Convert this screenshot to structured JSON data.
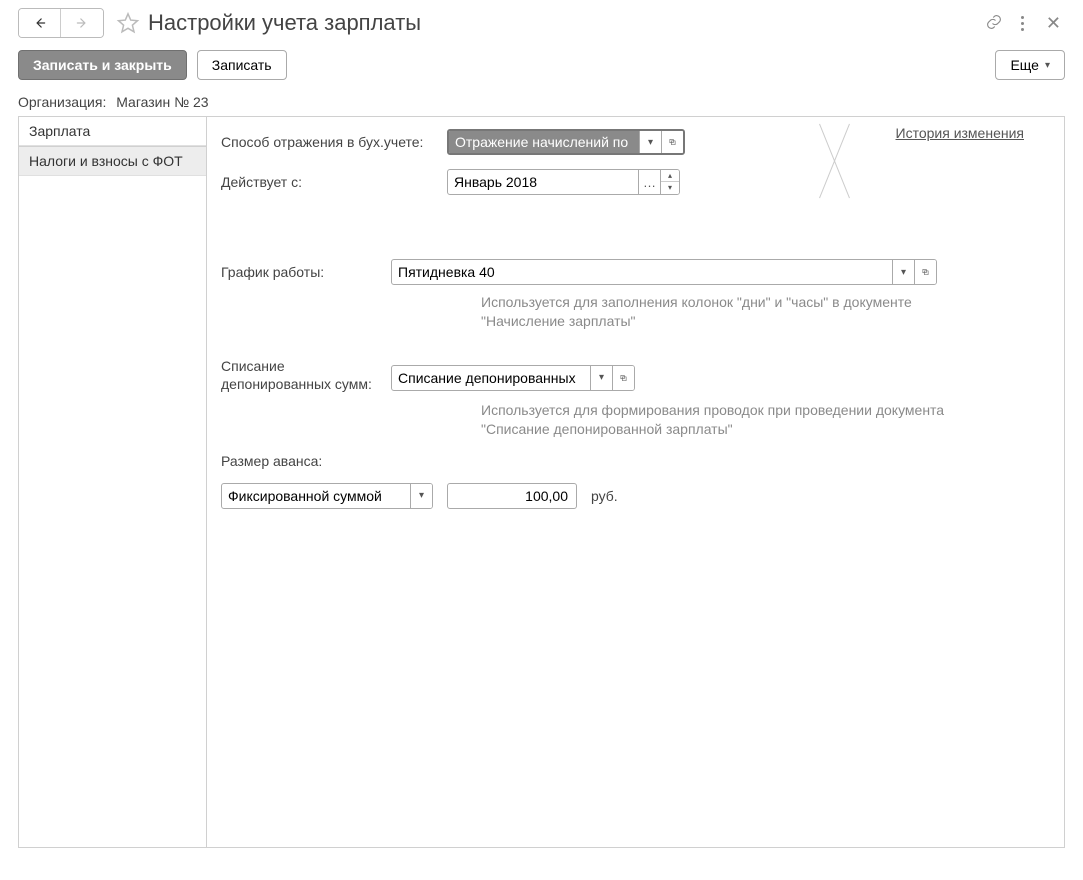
{
  "header": {
    "title": "Настройки учета зарплаты"
  },
  "toolbar": {
    "save_close": "Записать и закрыть",
    "save": "Записать",
    "more": "Еще"
  },
  "org": {
    "label": "Организация:",
    "value": "Магазин № 23"
  },
  "tabs": {
    "salary": "Зарплата",
    "taxes": "Налоги и взносы с ФОТ"
  },
  "form": {
    "reflect_label": "Способ отражения в бух.учете:",
    "reflect_value": "Отражение начислений по ",
    "history_link": "История изменения",
    "effective_label": "Действует с:",
    "effective_value": "Январь 2018",
    "schedule_label": "График работы:",
    "schedule_value": "Пятидневка 40",
    "schedule_hint": "Используется для заполнения колонок \"дни\" и \"часы\" в документе \"Начисление зарплаты\"",
    "writeoff_label": "Списание депонированных сумм:",
    "writeoff_value": "Списание депонированных",
    "writeoff_hint": "Используется для формирования проводок при проведении документа \"Списание депонированной зарплаты\"",
    "advance_label": "Размер аванса:",
    "advance_type": "Фиксированной суммой",
    "advance_amount": "100,00",
    "advance_unit": "руб."
  }
}
